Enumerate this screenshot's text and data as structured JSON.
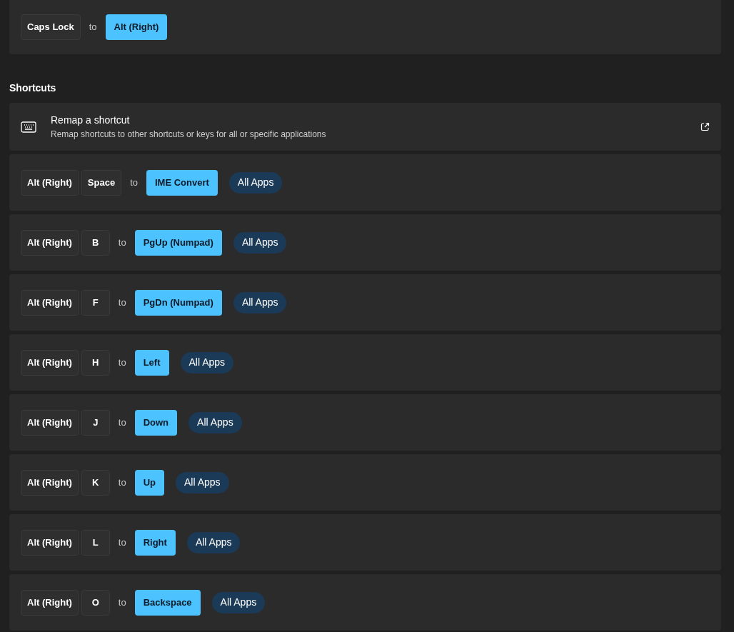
{
  "key_remaps": [
    {
      "from": [
        "Caps Lock"
      ],
      "to_word": "to",
      "to": "Alt (Right)"
    }
  ],
  "shortcuts_section": {
    "title": "Shortcuts",
    "remap_card": {
      "title": "Remap a shortcut",
      "description": "Remap shortcuts to other shortcuts or keys for all or specific applications"
    },
    "rows": [
      {
        "from": [
          "Alt (Right)",
          "Space"
        ],
        "to_word": "to",
        "to": "IME Convert",
        "scope": "All Apps"
      },
      {
        "from": [
          "Alt (Right)",
          "B"
        ],
        "to_word": "to",
        "to": "PgUp (Numpad)",
        "scope": "All Apps"
      },
      {
        "from": [
          "Alt (Right)",
          "F"
        ],
        "to_word": "to",
        "to": "PgDn (Numpad)",
        "scope": "All Apps"
      },
      {
        "from": [
          "Alt (Right)",
          "H"
        ],
        "to_word": "to",
        "to": "Left",
        "scope": "All Apps"
      },
      {
        "from": [
          "Alt (Right)",
          "J"
        ],
        "to_word": "to",
        "to": "Down",
        "scope": "All Apps"
      },
      {
        "from": [
          "Alt (Right)",
          "K"
        ],
        "to_word": "to",
        "to": "Up",
        "scope": "All Apps"
      },
      {
        "from": [
          "Alt (Right)",
          "L"
        ],
        "to_word": "to",
        "to": "Right",
        "scope": "All Apps"
      },
      {
        "from": [
          "Alt (Right)",
          "O"
        ],
        "to_word": "to",
        "to": "Backspace",
        "scope": "All Apps"
      }
    ]
  }
}
